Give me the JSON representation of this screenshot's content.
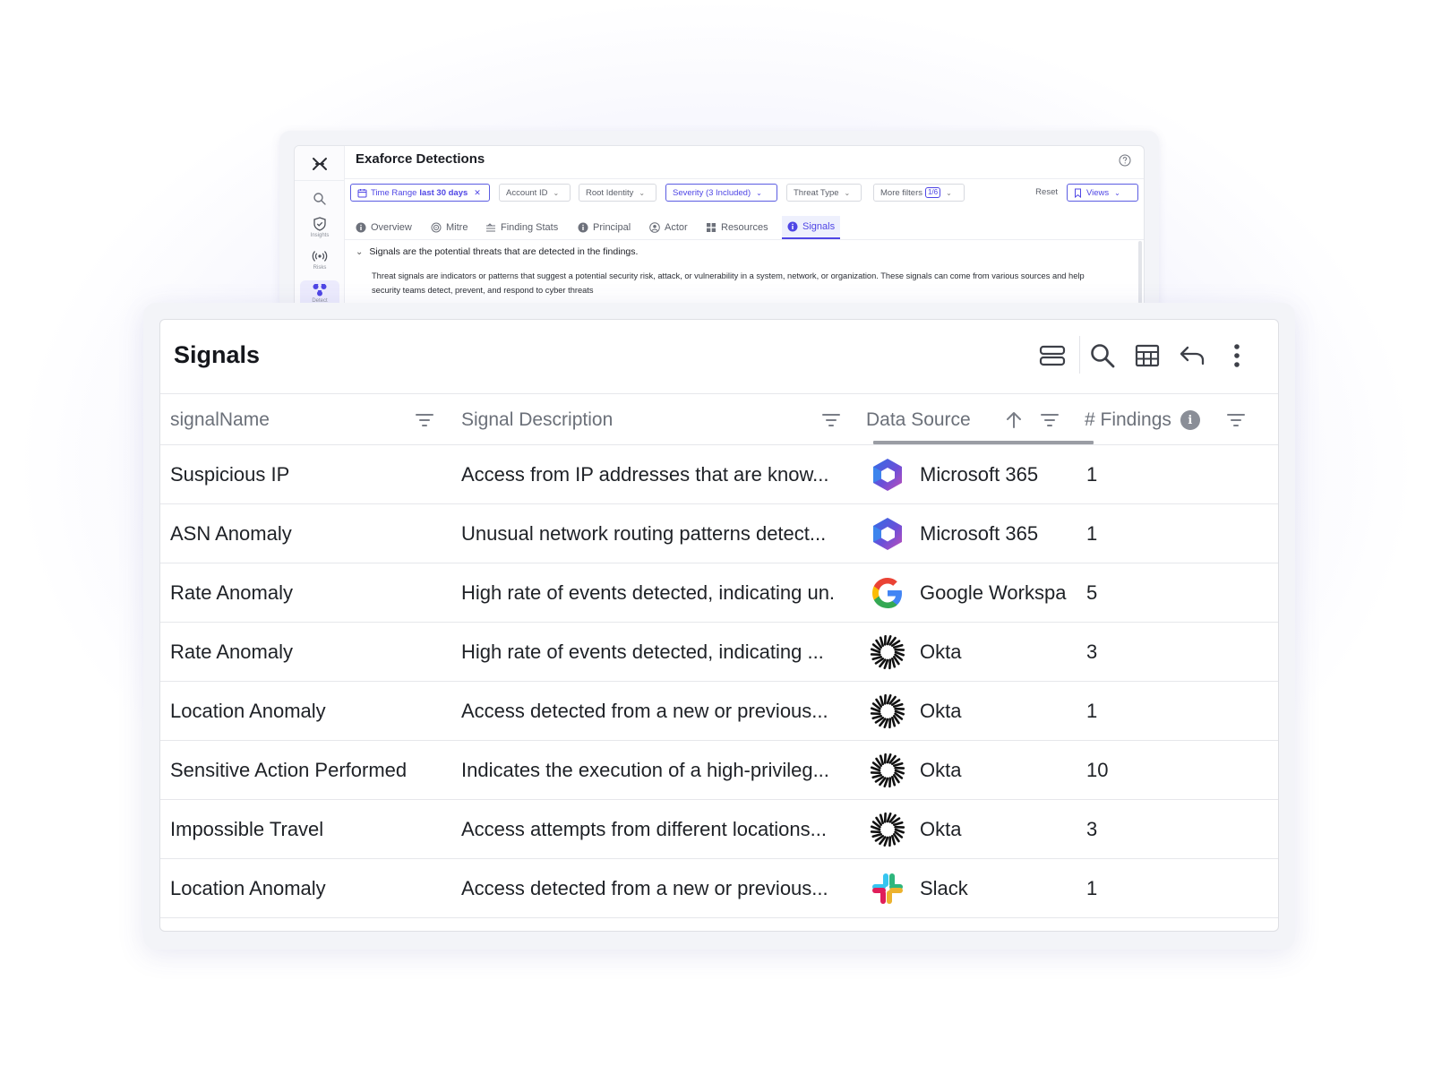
{
  "back_window": {
    "title": "Exaforce Detections",
    "sidebar": {
      "items": [
        {
          "label": "Insights"
        },
        {
          "label": "Risks"
        },
        {
          "label": "Detect"
        }
      ]
    },
    "filters": {
      "time_range": {
        "label": "Time Range",
        "value": "last 30 days"
      },
      "account_id": "Account ID",
      "root_identity": "Root Identity",
      "severity": "Severity (3 Included)",
      "threat_type": "Threat Type",
      "more_filters": {
        "label": "More filters",
        "badge": "1/6"
      },
      "reset": "Reset",
      "views": "Views"
    },
    "tabs": [
      {
        "label": "Overview",
        "icon": "info-circle-icon"
      },
      {
        "label": "Mitre",
        "icon": "target-icon"
      },
      {
        "label": "Finding Stats",
        "icon": "stats-icon"
      },
      {
        "label": "Principal",
        "icon": "info-circle-icon"
      },
      {
        "label": "Actor",
        "icon": "user-circle-icon"
      },
      {
        "label": "Resources",
        "icon": "grid-icon"
      },
      {
        "label": "Signals",
        "icon": "info-circle-icon",
        "active": true
      }
    ],
    "signals_heading": "Signals are the potential threats that are detected in the findings.",
    "signals_description": "Threat signals are indicators or patterns that suggest a potential security risk, attack, or vulnerability in a system, network, or organization. These signals can come from various sources and help security teams detect, prevent, and respond to cyber threats"
  },
  "signals_panel": {
    "title": "Signals",
    "columns": {
      "signal_name": "signalName",
      "signal_description": "Signal Description",
      "data_source": "Data Source",
      "findings": "# Findings"
    },
    "sorted_column": "data_source",
    "rows": [
      {
        "name": "Suspicious IP",
        "description": "Access from IP addresses that are know...",
        "source": "Microsoft 365",
        "source_icon": "microsoft-365-logo",
        "findings": "1"
      },
      {
        "name": "ASN Anomaly",
        "description": "Unusual network routing patterns detect...",
        "source": "Microsoft 365",
        "source_icon": "microsoft-365-logo",
        "findings": "1"
      },
      {
        "name": "Rate Anomaly",
        "description": "High rate of events detected, indicating un.",
        "source": "Google Workspa",
        "source_icon": "google-logo",
        "findings": "5"
      },
      {
        "name": "Rate Anomaly",
        "description": "High rate of events detected, indicating ...",
        "source": "Okta",
        "source_icon": "okta-logo",
        "findings": "3"
      },
      {
        "name": "Location Anomaly",
        "description": "Access detected from a new or previous...",
        "source": "Okta",
        "source_icon": "okta-logo",
        "findings": "1"
      },
      {
        "name": "Sensitive Action Performed",
        "description": "Indicates the execution of a high-privileg...",
        "source": "Okta",
        "source_icon": "okta-logo",
        "findings": "10"
      },
      {
        "name": "Impossible Travel",
        "description": "Access attempts from different locations...",
        "source": "Okta",
        "source_icon": "okta-logo",
        "findings": "3"
      },
      {
        "name": "Location Anomaly",
        "description": "Access detected from a new or previous...",
        "source": "Slack",
        "source_icon": "slack-logo",
        "findings": "1"
      }
    ]
  }
}
